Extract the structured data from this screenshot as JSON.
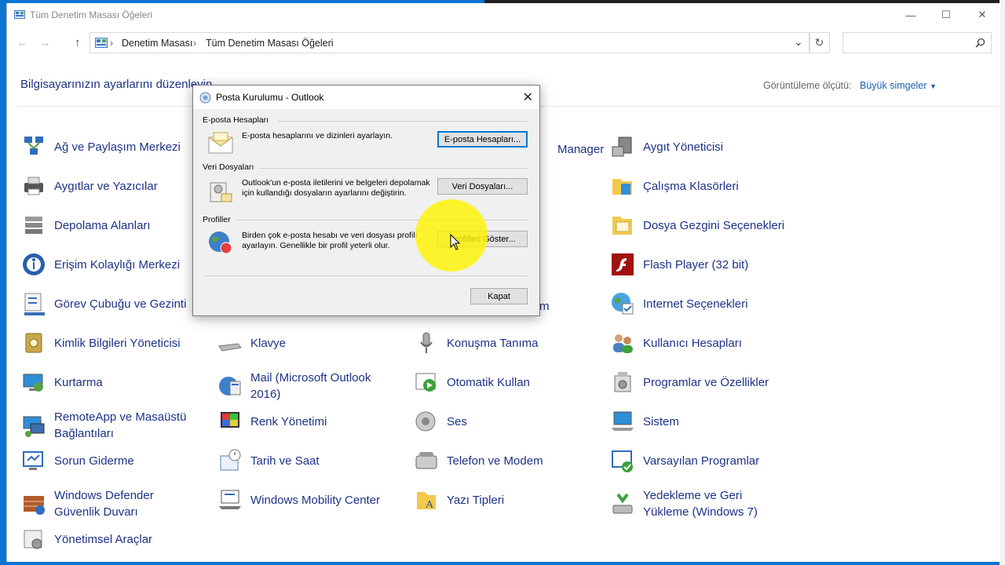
{
  "window": {
    "title": "Tüm Denetim Masası Öğeleri",
    "minimize_symbol": "—",
    "maximize_symbol": "☐",
    "close_symbol": "✕"
  },
  "address": {
    "back_symbol": "←",
    "forward_symbol": "→",
    "up_symbol": "↑",
    "separator": "›",
    "breadcrumbs": [
      "Denetim Masası",
      "Tüm Denetim Masası Öğeleri"
    ],
    "dropdown_symbol": "⌄",
    "refresh_symbol": "↻",
    "search_placeholder": ""
  },
  "header": {
    "title": "Bilgisayarınızın ayarlarını düzenleyin",
    "view_label": "Görüntüleme ölçütü:",
    "view_value": "Büyük simgeler"
  },
  "items": [
    {
      "label": "Ağ ve Paylaşım Merkezi",
      "icon": "network-icon"
    },
    {
      "label": "Aygıtlar ve Yazıcılar",
      "icon": "printer-icon"
    },
    {
      "label": "Depolama Alanları",
      "icon": "storage-icon"
    },
    {
      "label": "Erişim Kolaylığı Merkezi",
      "icon": "accessibility-icon"
    },
    {
      "label": "Görev Çubuğu ve Gezinti",
      "icon": "taskbar-icon"
    },
    {
      "label": "Kimlik Bilgileri Yöneticisi",
      "icon": "credential-icon"
    },
    {
      "label": "Kurtarma",
      "icon": "recovery-icon"
    },
    {
      "label": "RemoteApp ve Masaüstü Bağlantıları",
      "icon": "remoteapp-icon"
    },
    {
      "label": "Sorun Giderme",
      "icon": "troubleshoot-icon"
    },
    {
      "label": "Windows Defender Güvenlik Duvarı",
      "icon": "firewall-icon"
    },
    {
      "label": "Yönetimsel Araçlar",
      "icon": "admin-tools-icon"
    },
    {
      "label": "Klavye",
      "icon": "keyboard-icon"
    },
    {
      "label": "Mail (Microsoft Outlook 2016)",
      "icon": "mail-icon"
    },
    {
      "label": "Renk Yönetimi",
      "icon": "color-icon"
    },
    {
      "label": "Tarih ve Saat",
      "icon": "datetime-icon"
    },
    {
      "label": "Windows Mobility Center",
      "icon": "mobility-icon"
    },
    {
      "label": "Konuşma Tanıma",
      "icon": "microphone-icon"
    },
    {
      "label": "Otomatik Kullan",
      "icon": "autoplay-icon"
    },
    {
      "label": "Ses",
      "icon": "speaker-icon"
    },
    {
      "label": "Telefon ve Modem",
      "icon": "phone-icon"
    },
    {
      "label": "Yazı Tipleri",
      "icon": "fonts-icon"
    },
    {
      "label": "Aygıt Yöneticisi",
      "icon": "device-manager-icon"
    },
    {
      "label": "Çalışma Klasörleri",
      "icon": "work-folders-icon"
    },
    {
      "label": "Dosya Gezgini Seçenekleri",
      "icon": "folder-options-icon"
    },
    {
      "label": "Flash Player (32 bit)",
      "icon": "flash-icon"
    },
    {
      "label": "Internet Seçenekleri",
      "icon": "internet-icon"
    },
    {
      "label": "Kullanıcı Hesapları",
      "icon": "users-icon"
    },
    {
      "label": "Programlar ve Özellikler",
      "icon": "programs-icon"
    },
    {
      "label": "Sistem",
      "icon": "system-icon"
    },
    {
      "label": "Varsayılan Programlar",
      "icon": "default-programs-icon"
    },
    {
      "label": "Yedekleme ve Geri Yükleme (Windows 7)",
      "icon": "backup-icon"
    }
  ],
  "partial_labels": {
    "manager": "Manager",
    "m": "m"
  },
  "dialog": {
    "title": "Posta Kurulumu - Outlook",
    "close_symbol": "✕",
    "email_group": "E-posta Hesapları",
    "email_desc": "E-posta hesaplarını ve dizinleri ayarlayın.",
    "email_button": "E-posta Hesapları...",
    "data_group": "Veri Dosyaları",
    "data_desc": "Outlook'un e-posta iletilerini ve belgeleri depolamak için kullandığı dosyaların ayarlarını değiştirin.",
    "data_button": "Veri Dosyaları...",
    "profile_group": "Profiller",
    "profile_desc": "Birden çok e-posta hesabı ve veri dosyası profili ayarlayın. Genellikle bir profil yeterli olur.",
    "profile_button": "Profilleri Göster...",
    "close_button": "Kapat"
  }
}
